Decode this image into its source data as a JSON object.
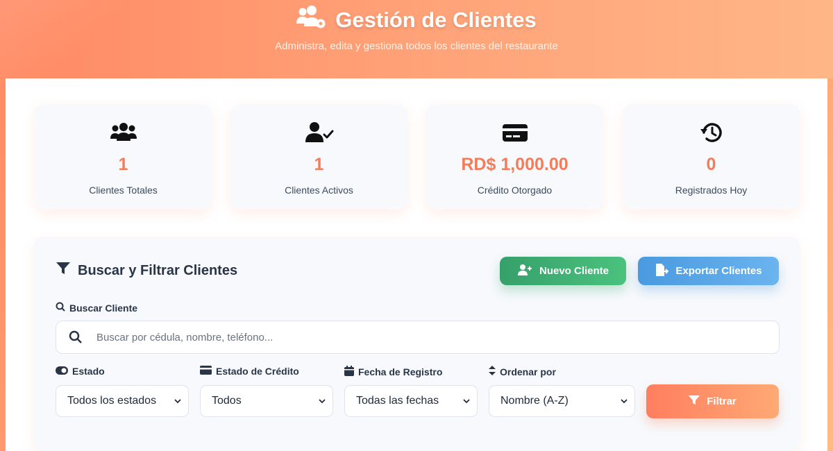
{
  "header": {
    "title": "Gestión de Clientes",
    "subtitle": "Administra, edita y gestiona todos los clientes del restaurante"
  },
  "stats": [
    {
      "icon": "users-icon",
      "value": "1",
      "label": "Clientes Totales"
    },
    {
      "icon": "user-check-icon",
      "value": "1",
      "label": "Clientes Activos"
    },
    {
      "icon": "credit-card-icon",
      "value": "RD$ 1,000.00",
      "label": "Crédito Otorgado"
    },
    {
      "icon": "history-icon",
      "value": "0",
      "label": "Registrados Hoy"
    }
  ],
  "panel": {
    "title": "Buscar y Filtrar Clientes",
    "new_button": "Nuevo Cliente",
    "export_button": "Exportar Clientes",
    "search_label": "Buscar Cliente",
    "search_placeholder": "Buscar por cédula, nombre, teléfono...",
    "filters": [
      {
        "label": "Estado",
        "value": "Todos los estados"
      },
      {
        "label": "Estado de Crédito",
        "value": "Todos"
      },
      {
        "label": "Fecha de Registro",
        "value": "Todas las fechas"
      },
      {
        "label": "Ordenar por",
        "value": "Nombre (A-Z)"
      }
    ],
    "filter_button": "Filtrar"
  },
  "colors": {
    "accent": "#f47c5a",
    "green": "#3fae72",
    "blue": "#58a6e8"
  }
}
